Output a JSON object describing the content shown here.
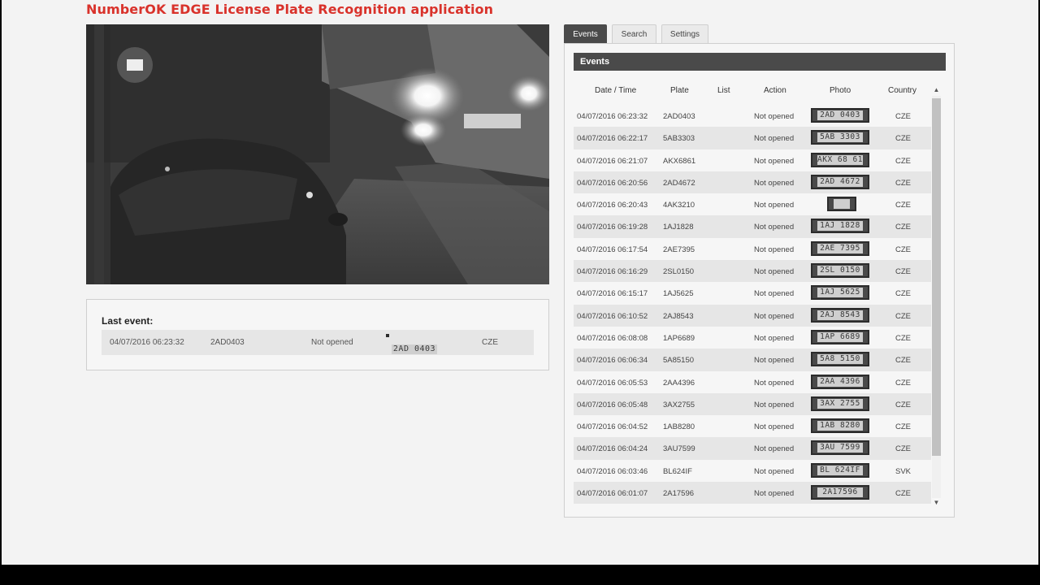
{
  "app": {
    "title": "NumberOK EDGE License Plate Recognition application"
  },
  "last_event": {
    "heading": "Last event:",
    "datetime": "04/07/2016 06:23:32",
    "plate": "2AD0403",
    "action": "Not opened",
    "photo_text": "2AD 0403",
    "country": "CZE"
  },
  "tabs": [
    {
      "label": "Events",
      "active": true
    },
    {
      "label": "Search",
      "active": false
    },
    {
      "label": "Settings",
      "active": false
    }
  ],
  "events": {
    "header": "Events",
    "columns": [
      "Date / Time",
      "Plate",
      "List",
      "Action",
      "Photo",
      "Country"
    ],
    "rows": [
      {
        "datetime": "04/07/2016 06:23:32",
        "plate": "2AD0403",
        "list": "",
        "action": "Not opened",
        "photo": "2AD 0403",
        "country": "CZE"
      },
      {
        "datetime": "04/07/2016 06:22:17",
        "plate": "5AB3303",
        "list": "",
        "action": "Not opened",
        "photo": "5AB 3303",
        "country": "CZE"
      },
      {
        "datetime": "04/07/2016 06:21:07",
        "plate": "AKX6861",
        "list": "",
        "action": "Not opened",
        "photo": "AKX 68 61",
        "country": "CZE"
      },
      {
        "datetime": "04/07/2016 06:20:56",
        "plate": "2AD4672",
        "list": "",
        "action": "Not opened",
        "photo": "2AD 4672",
        "country": "CZE"
      },
      {
        "datetime": "04/07/2016 06:20:43",
        "plate": "4AK3210",
        "list": "",
        "action": "Not opened",
        "photo": "",
        "country": "CZE"
      },
      {
        "datetime": "04/07/2016 06:19:28",
        "plate": "1AJ1828",
        "list": "",
        "action": "Not opened",
        "photo": "1AJ 1828",
        "country": "CZE"
      },
      {
        "datetime": "04/07/2016 06:17:54",
        "plate": "2AE7395",
        "list": "",
        "action": "Not opened",
        "photo": "2AE 7395",
        "country": "CZE"
      },
      {
        "datetime": "04/07/2016 06:16:29",
        "plate": "2SL0150",
        "list": "",
        "action": "Not opened",
        "photo": "2SL 0150",
        "country": "CZE"
      },
      {
        "datetime": "04/07/2016 06:15:17",
        "plate": "1AJ5625",
        "list": "",
        "action": "Not opened",
        "photo": "1AJ 5625",
        "country": "CZE"
      },
      {
        "datetime": "04/07/2016 06:10:52",
        "plate": "2AJ8543",
        "list": "",
        "action": "Not opened",
        "photo": "2AJ 8543",
        "country": "CZE"
      },
      {
        "datetime": "04/07/2016 06:08:08",
        "plate": "1AP6689",
        "list": "",
        "action": "Not opened",
        "photo": "1AP 6689",
        "country": "CZE"
      },
      {
        "datetime": "04/07/2016 06:06:34",
        "plate": "5A85150",
        "list": "",
        "action": "Not opened",
        "photo": "5A8 5150",
        "country": "CZE"
      },
      {
        "datetime": "04/07/2016 06:05:53",
        "plate": "2AA4396",
        "list": "",
        "action": "Not opened",
        "photo": "2AA 4396",
        "country": "CZE"
      },
      {
        "datetime": "04/07/2016 06:05:48",
        "plate": "3AX2755",
        "list": "",
        "action": "Not opened",
        "photo": "3AX 2755",
        "country": "CZE"
      },
      {
        "datetime": "04/07/2016 06:04:52",
        "plate": "1AB8280",
        "list": "",
        "action": "Not opened",
        "photo": "1AB 8280",
        "country": "CZE"
      },
      {
        "datetime": "04/07/2016 06:04:24",
        "plate": "3AU7599",
        "list": "",
        "action": "Not opened",
        "photo": "3AU 7599",
        "country": "CZE"
      },
      {
        "datetime": "04/07/2016 06:03:46",
        "plate": "BL624IF",
        "list": "",
        "action": "Not opened",
        "photo": "BL 624IF",
        "country": "SVK"
      },
      {
        "datetime": "04/07/2016 06:01:07",
        "plate": "2A17596",
        "list": "",
        "action": "Not opened",
        "photo": "2A17596",
        "country": "CZE"
      },
      {
        "datetime": "",
        "plate": "",
        "list": "",
        "action": "",
        "photo": "",
        "country": ""
      }
    ]
  },
  "colors": {
    "title_red": "#d9322b",
    "dark_header": "#4a4a4a",
    "row_alt": "#e6e6e6"
  },
  "icons": {
    "scroll_up": "triangle-up-icon",
    "scroll_down": "triangle-down-icon"
  }
}
